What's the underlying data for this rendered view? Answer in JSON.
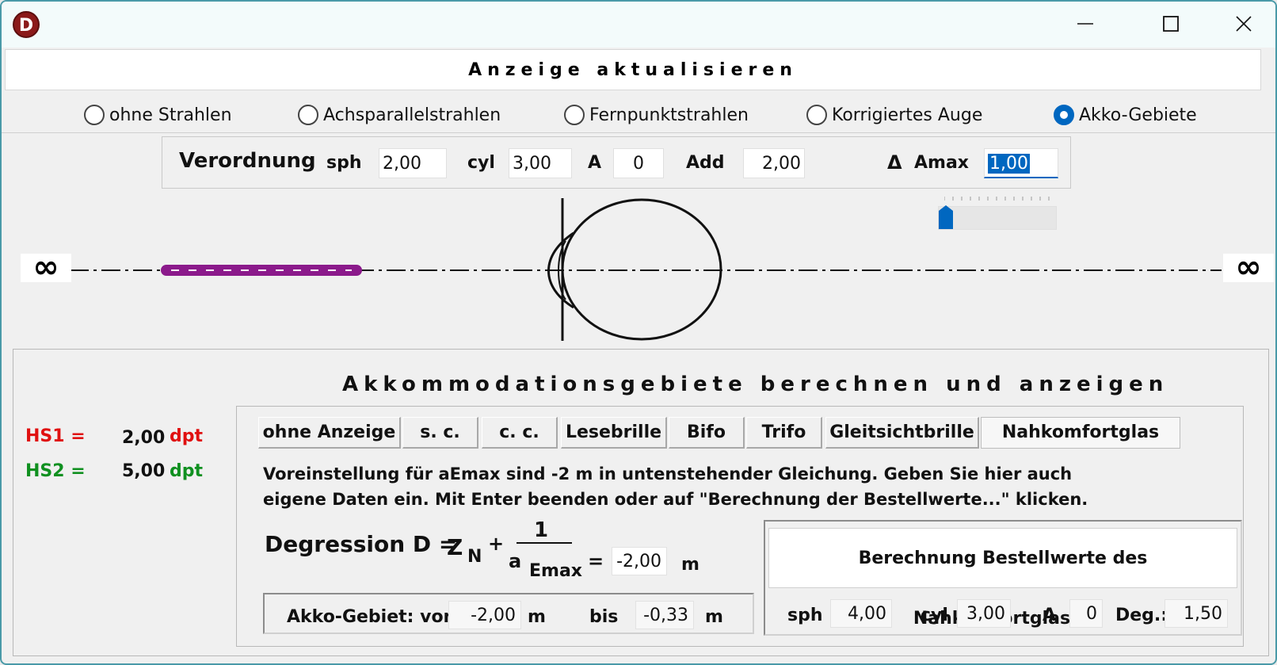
{
  "window": {
    "logo_letter": "D"
  },
  "update_button": "Anzeige aktualisieren",
  "radio_options": [
    {
      "label": "ohne Strahlen",
      "selected": false
    },
    {
      "label": "Achsparallelstrahlen",
      "selected": false
    },
    {
      "label": "Fernpunktstrahlen",
      "selected": false
    },
    {
      "label": "Korrigiertes Auge",
      "selected": false
    },
    {
      "label": "Akko-Gebiete",
      "selected": true
    }
  ],
  "prescription": {
    "title": "Verordnung",
    "sph_label": "sph",
    "sph": "2,00",
    "cyl_label": "cyl",
    "cyl": "3,00",
    "a_label": "A",
    "a": "0",
    "add_label": "Add",
    "add": "2,00",
    "delta_symbol": "Δ",
    "amax_label": "Amax",
    "amax": "1,00"
  },
  "slider": {
    "value_fraction": 0.0
  },
  "diagram": {
    "infinity_left": "∞",
    "infinity_right": "∞",
    "akko_range_color": "#8b1a8b"
  },
  "akko_section": {
    "heading": "Akkommodationsgebiete berechnen und anzeigen",
    "hs1_label": "HS1 =",
    "hs1_value": "2,00",
    "hs1_unit": "dpt",
    "hs2_label": "HS2 =",
    "hs2_value": "5,00",
    "hs2_unit": "dpt",
    "tabs": [
      {
        "label": "ohne Anzeige",
        "active": false
      },
      {
        "label": "s. c.",
        "active": false
      },
      {
        "label": "c. c.",
        "active": false
      },
      {
        "label": "Lesebrille",
        "active": false
      },
      {
        "label": "Bifo",
        "active": false
      },
      {
        "label": "Trifo",
        "active": false
      },
      {
        "label": "Gleitsichtbrille",
        "active": false
      },
      {
        "label": "Nahkomfortglas",
        "active": true
      }
    ],
    "description_line1": "Voreinstellung für aEmax sind -2 m in untenstehender Gleichung. Geben Sie hier auch",
    "description_line2": "eigene Daten ein. Mit Enter beenden oder auf \"Berechnung der Bestellwerte...\" klicken.",
    "formula": {
      "lhs": "Degression D =",
      "z": "Z",
      "z_sub": "N",
      "plus": "+",
      "numerator": "1",
      "denom_a": "a",
      "denom_sub": "Emax",
      "equals": "=",
      "value": "-2,00",
      "unit": "m"
    },
    "akko_range": {
      "label": "Akko-Gebiet: von",
      "from": "-2,00",
      "from_unit": "m",
      "to_label": "bis",
      "to": "-0,33",
      "to_unit": "m"
    },
    "calc_button": "Berechnung Bestellwerte des Nahkomfortglases",
    "order": {
      "sph_label": "sph",
      "sph": "4,00",
      "cyl_label": "cyl",
      "cyl": "3,00",
      "a_label": "A",
      "a": "0",
      "deg_label": "Deg.:",
      "deg": "1,50"
    }
  }
}
